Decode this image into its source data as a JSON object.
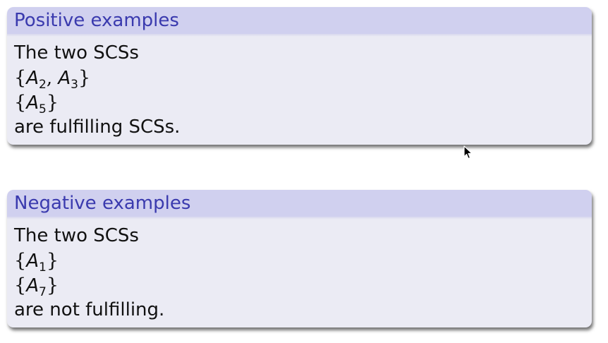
{
  "positive": {
    "title": "Positive examples",
    "intro": "The two SCSs",
    "sets": [
      {
        "open": "{",
        "vars": [
          {
            "name": "A",
            "sub": "2"
          },
          {
            "name": "A",
            "sub": "3"
          }
        ],
        "sep": ", ",
        "close": "}"
      },
      {
        "open": "{",
        "vars": [
          {
            "name": "A",
            "sub": "5"
          }
        ],
        "sep": "",
        "close": "}"
      }
    ],
    "conclusion": "are fulfilling SCSs."
  },
  "negative": {
    "title": "Negative examples",
    "intro": "The two SCSs",
    "sets": [
      {
        "open": "{",
        "vars": [
          {
            "name": "A",
            "sub": "1"
          }
        ],
        "sep": "",
        "close": "}"
      },
      {
        "open": "{",
        "vars": [
          {
            "name": "A",
            "sub": "7"
          }
        ],
        "sep": "",
        "close": "}"
      }
    ],
    "conclusion": "are not fulfilling."
  },
  "colors": {
    "title_text": "#3a3aae",
    "title_bg": "#d0d0ef",
    "body_bg": "#ebebf4"
  },
  "icons": {
    "cursor": "mouse-pointer-icon"
  }
}
